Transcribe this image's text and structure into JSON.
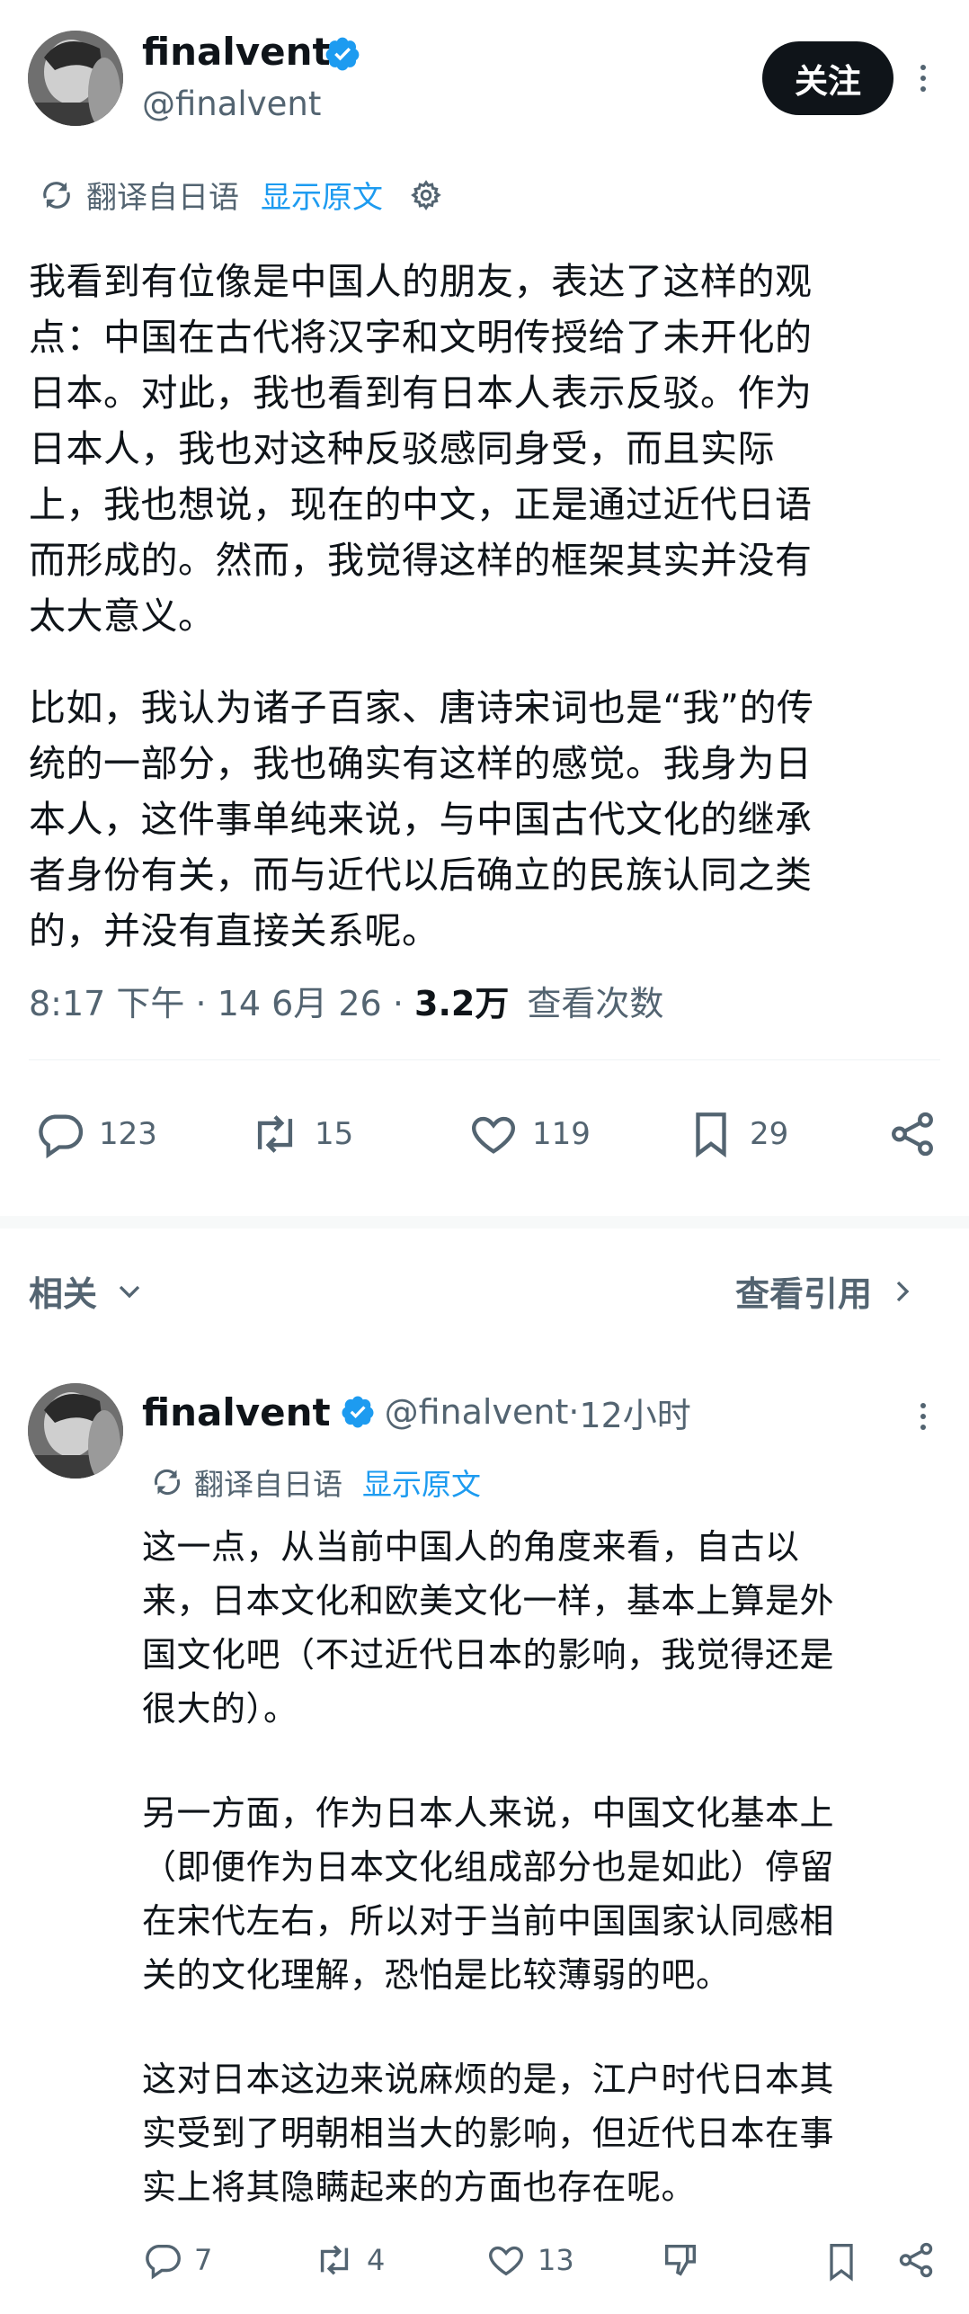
{
  "main_tweet": {
    "author_name": "finalvent",
    "handle": "@finalvent",
    "follow_label": "关注",
    "translated_from": "翻译自日语",
    "show_original": "显示原文",
    "body_p1": "我看到有位像是中国人的朋友，表达了这样的观\n点：中国在古代将汉字和文明传授给了未开化的\n日本。对此，我也看到有日本人表示反驳。作为\n日本人，我也对这种反驳感同身受，而且实际\n上，我也想说，现在的中文，正是通过近代日语\n而形成的。然而，我觉得这样的框架其实并没有\n太大意义。",
    "body_p2": "比如，我认为诸子百家、唐诗宋词也是“我”的传\n统的一部分，我也确实有这样的感觉。我身为日\n本人，这件事单纯来说，与中国古代文化的继承\n者身份有关，而与近代以后确立的民族认同之类\n的，并没有直接关系呢。",
    "time": "8:17 下午",
    "date": "14 6月 26",
    "views_count": "3.2万",
    "views_label": "查看次数",
    "replies": "123",
    "retweets": "15",
    "likes": "119",
    "bookmarks": "29"
  },
  "related": {
    "label": "相关",
    "view_quotes": "查看引用"
  },
  "reply_tweet": {
    "author_name": "finalvent",
    "handle": "@finalvent",
    "time_ago": "12小时",
    "translated_from": "翻译自日语",
    "show_original": "显示原文",
    "body_p1": "这一点，从当前中国人的角度来看，自古以\n来，日本文化和欧美文化一样，基本上算是外\n国文化吧（不过近代日本的影响，我觉得还是\n很大的）。",
    "body_p2": "另一方面，作为日本人来说，中国文化基本上\n（即便作为日本文化组成部分也是如此）停留\n在宋代左右，所以对于当前中国国家认同感相\n关的文化理解，恐怕是比较薄弱的吧。",
    "body_p3": "这对日本这边来说麻烦的是，江户时代日本其\n实受到了明朝相当大的影响，但近代日本在事\n实上将其隐瞒起来的方面也存在呢。",
    "replies": "7",
    "retweets": "4",
    "likes": "13"
  },
  "colors": {
    "text": "#0f1419",
    "muted": "#536471",
    "link": "#1d9bf0",
    "verified": "#1d9bf0",
    "divider": "#eff3f4"
  },
  "icons": [
    "verified-icon",
    "translate-icon",
    "gear-icon",
    "more-icon",
    "reply-icon",
    "retweet-icon",
    "like-icon",
    "bookmark-icon",
    "share-icon",
    "chevron-down-icon",
    "chevron-right-icon",
    "dislike-icon"
  ]
}
